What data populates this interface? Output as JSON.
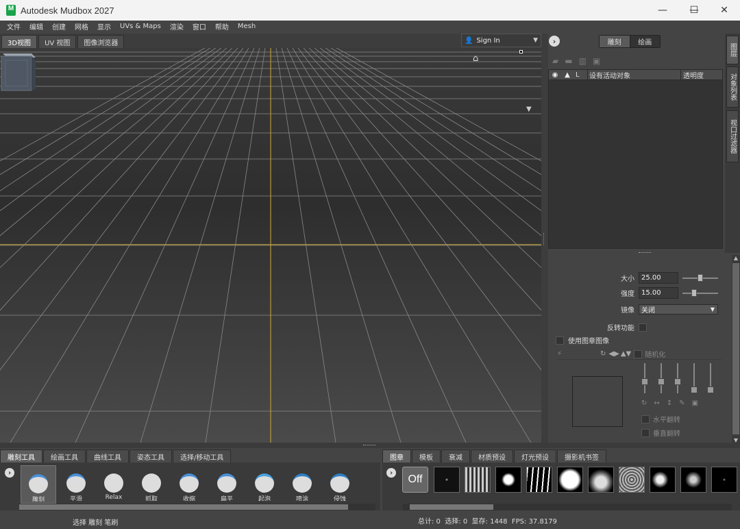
{
  "app": {
    "title": "Autodesk Mudbox 2027",
    "icon_letter": "M"
  },
  "window_controls": {
    "minimize": "—",
    "maximize": "☐",
    "close": "✕"
  },
  "menu": [
    "文件",
    "编辑",
    "创建",
    "网格",
    "显示",
    "UVs & Maps",
    "渲染",
    "窗口",
    "帮助",
    "Mesh"
  ],
  "viewport_tabs": [
    "3D视图",
    "UV 视图",
    "图像浏览器"
  ],
  "signin": {
    "label": "Sign In"
  },
  "mode_switch": {
    "sculpt": "雕刻",
    "paint": "绘画"
  },
  "layers": {
    "columns": {
      "lock": "",
      "l": "L",
      "name": "设有活动对象",
      "opacity": "透明度"
    }
  },
  "side_tabs": [
    "图层",
    "对象列表",
    "视口过滤器"
  ],
  "properties": {
    "size_label": "大小",
    "size_value": "25.00",
    "size_level": 0.5,
    "strength_label": "强度",
    "strength_value": "15.00",
    "strength_level": 0.3,
    "mirror_label": "镜像",
    "mirror_value": "关闭",
    "invert_label": "反转功能",
    "use_stamp_label": "使用图章图像",
    "randomize_label": "随机化",
    "flip_h_label": "水平翻转",
    "flip_v_label": "垂直翻转"
  },
  "tool_tabs": [
    "雕刻工具",
    "绘画工具",
    "曲线工具",
    "姿态工具",
    "选择/移动工具"
  ],
  "tools": [
    "雕刻",
    "平滑",
    "Relax",
    "抓取",
    "收缩",
    "扁平",
    "起泡",
    "喷涂",
    "侵蚀"
  ],
  "stamp_tabs": [
    "图章",
    "模板",
    "衰减",
    "材质预设",
    "灯光预设",
    "摄影机书签"
  ],
  "stamp_off": "Off",
  "status": {
    "left": "选择 雕刻 笔刷",
    "right": "总计: 0  选择: 0  显存: 1448  FPS: 37.8179"
  }
}
